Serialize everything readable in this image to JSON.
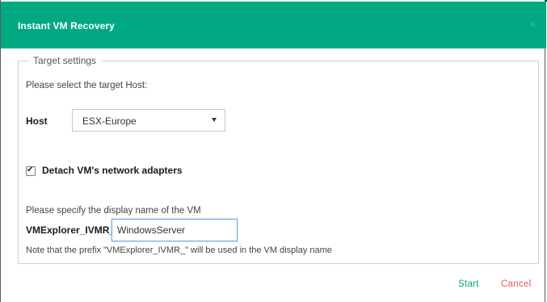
{
  "dialog": {
    "title": "Instant VM Recovery",
    "close_icon": "×"
  },
  "target_settings": {
    "legend": "Target settings",
    "instruction": "Please select the target Host:",
    "host_label": "Host",
    "host_selected": "ESX-Europe",
    "detach_checked": true,
    "detach_label": "Detach VM's network adapters",
    "display_name_instruction": "Please specify the display name of the VM",
    "prefix_label": "VMExplorer_IVMR_",
    "display_name_value": "WindowsServer",
    "note": "Note that the prefix \"VMExplorer_IVMR_\" will be used in the VM display name"
  },
  "footer": {
    "start_label": "Start",
    "cancel_label": "Cancel"
  },
  "colors": {
    "header": "#01a982",
    "start": "#01a982",
    "cancel": "#e85a5a",
    "input_focus_border": "#6aa8e8"
  }
}
